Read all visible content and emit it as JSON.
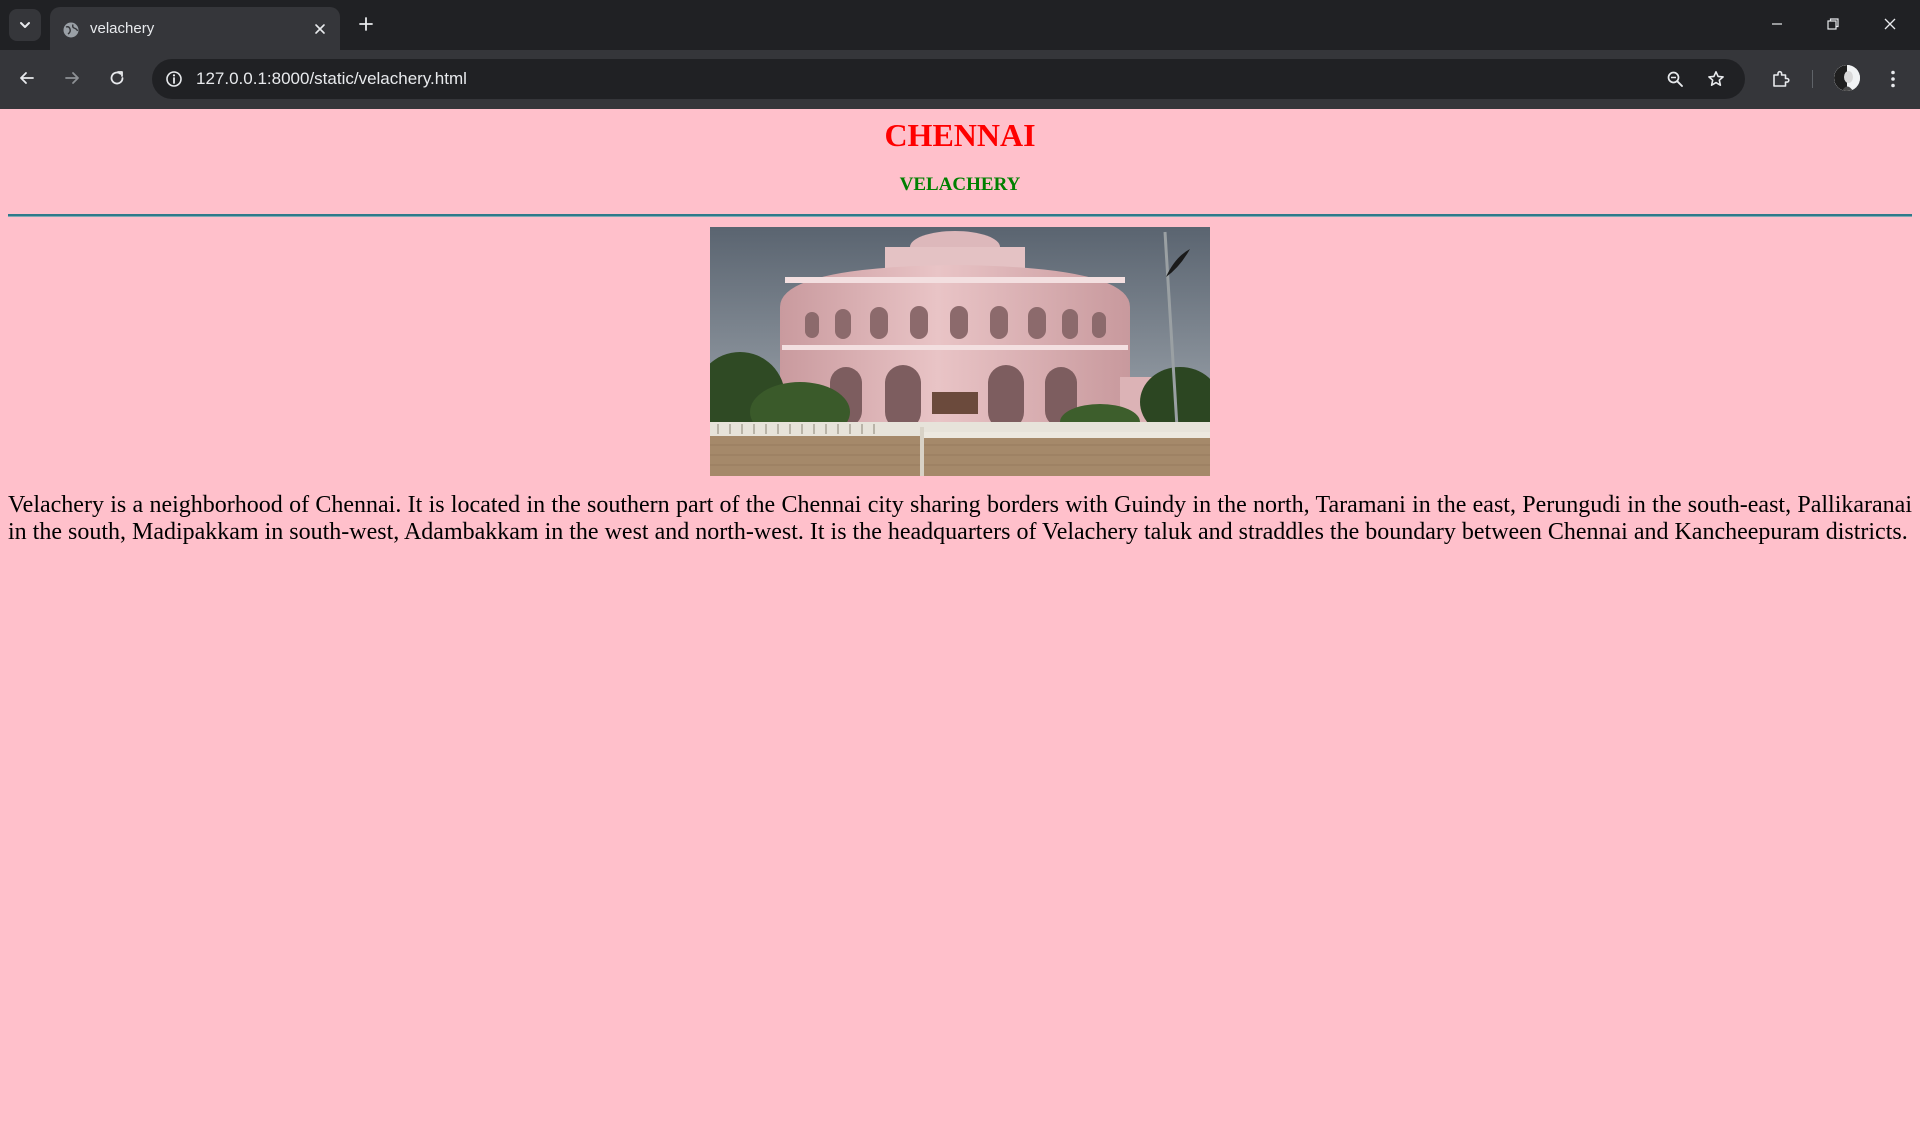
{
  "browser": {
    "tab_title": "velachery",
    "url": "127.0.0.1:8000/static/velachery.html",
    "icons": {
      "tab_search": "chevron-down-icon",
      "favicon": "globe-icon",
      "tab_close": "close-icon",
      "new_tab": "plus-icon",
      "minimize": "minimize-icon",
      "restore": "restore-icon",
      "close_window": "close-icon",
      "back": "arrow-left-icon",
      "forward": "arrow-right-icon",
      "reload": "reload-icon",
      "site_info": "info-icon",
      "zoom": "zoom-out-icon",
      "bookmark": "star-icon",
      "extensions": "puzzle-icon",
      "profile": "avatar",
      "menu": "kebab-menu-icon"
    },
    "colors": {
      "frame": "#202124",
      "toolbar": "#35363a",
      "omnibox": "#202124",
      "text": "#e8eaed"
    }
  },
  "page": {
    "title": "CHENNAI",
    "subtitle": "VELACHERY",
    "paragraph": "Velachery is a neighborhood of Chennai. It is located in the southern part of the Chennai city sharing borders with Guindy in the north, Taramani in the east, Perungudi in the south-east, Pallikaranai in the south, Madipakkam in south-west, Adambakkam in the west and north-west. It is the headquarters of Velachery taluk and straddles the boundary between Chennai and Kancheepuram districts.",
    "colors": {
      "background": "#ffc0cb",
      "title": "#ff0000",
      "subtitle": "#008000",
      "rule": "#2f7a8a"
    }
  }
}
